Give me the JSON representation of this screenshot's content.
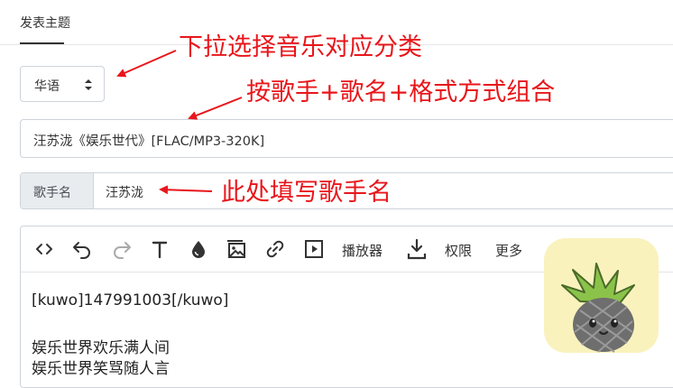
{
  "tab": {
    "label": "发表主题"
  },
  "category_select": {
    "value": "华语"
  },
  "title_input": {
    "value": "汪苏泷《娱乐世代》[FLAC/MP3-320K]"
  },
  "singer_field": {
    "label": "歌手名",
    "value": "汪苏泷"
  },
  "toolbar": {
    "icons": [
      "code-icon",
      "undo-icon",
      "redo-icon",
      "text-format-icon",
      "color-drop-icon",
      "image-icon",
      "link-icon",
      "video-icon",
      "download-icon"
    ],
    "player_label": "播放器",
    "permission_label": "权限",
    "more_label": "更多"
  },
  "editor": {
    "lines": [
      "[kuwo]147991003[/kuwo]",
      "娱乐世界欢乐满人间",
      "娱乐世界笑骂随人言"
    ]
  },
  "annotations": {
    "select_note": "下拉选择音乐对应分类",
    "title_note": "按歌手+歌名+格式方式组合",
    "singer_note": "此处填写歌手名",
    "color": "#e8161b"
  },
  "colors": {
    "accent_red": "#e8161b",
    "addon_bg": "#e9ecef",
    "border": "#ced4da",
    "mascot_bg": "#f9f2bd"
  }
}
